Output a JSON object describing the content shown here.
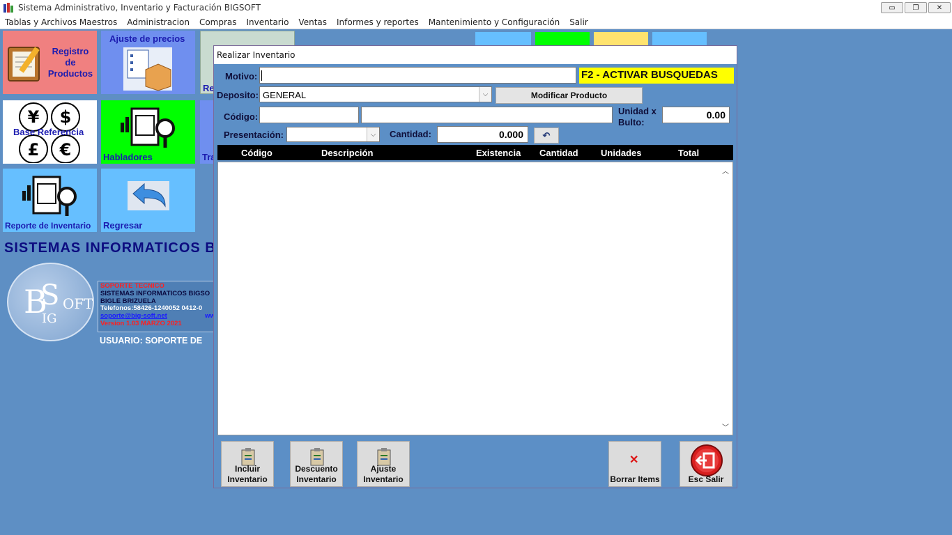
{
  "window": {
    "title": "Sistema Administrativo, Inventario y Facturación BIGSOFT",
    "buttons": {
      "minimize": "▭",
      "restore": "❐",
      "close": "✕"
    }
  },
  "menu": [
    "Tablas y Archivos Maestros",
    "Administracion",
    "Compras",
    "Inventario",
    "Ventas",
    "Informes y reportes",
    "Mantenimiento y Configuración",
    "Salir"
  ],
  "tiles": {
    "registro": "Registro\nde\nProductos",
    "ajuste_precios": "Ajuste de precios",
    "reporte_partial": "Re",
    "base_referencia": "Base Referencia",
    "habladores": "Habladores",
    "traslado_partial": "Tra",
    "reporte_inventario": "Reporte de Inventario",
    "regresar": "Regresar",
    "colors": {
      "pink": "#f08080",
      "blue": "#6f8fef",
      "green": "#00ff00",
      "lightblue": "#66bfff",
      "white": "#ffffff"
    }
  },
  "brand": {
    "title": "SISTEMAS INFORMATICOS B",
    "logo_text": "BSOFT\nBIG",
    "support": {
      "label": "SOPORTE TECNICO",
      "company": "SISTEMAS INFORMATICOS BIGSO",
      "name": "BIGLE BRIZUELA",
      "phones": "Telefonos:58426-1240052 0412-0",
      "email": "soporte@big-soft.net",
      "email_suffix": "ww",
      "version": "Version 1.03 MARZO 2021"
    },
    "user": "USUARIO: SOPORTE DE"
  },
  "dialog": {
    "title": "Realizar Inventario",
    "motivo_label": "Motivo:",
    "motivo_value": "",
    "f2_banner": "F2 - ACTIVAR BUSQUEDAS",
    "deposito_label": "Deposito:",
    "deposito_value": "GENERAL",
    "modificar_button": "Modificar Producto",
    "codigo_label": "Código:",
    "codigo_value": "",
    "descripcion_value": "",
    "unidad_label": "Unidad x\nBulto:",
    "unidad_value": "0.00",
    "presentacion_label": "Presentación:",
    "presentacion_value": "",
    "cantidad_label": "Cantidad:",
    "cantidad_value": "0.000",
    "undo_icon": "↶",
    "columns": [
      "Código",
      "Descripción",
      "Existencia",
      "Cantidad",
      "Unidades",
      "Total"
    ],
    "buttons": {
      "incluir": "Incluir\nInventario",
      "descuento": "Descuento\nInventario",
      "ajuste": "Ajuste\nInventario",
      "borrar": "Borrar Items",
      "salir": "Esc Salir"
    }
  }
}
